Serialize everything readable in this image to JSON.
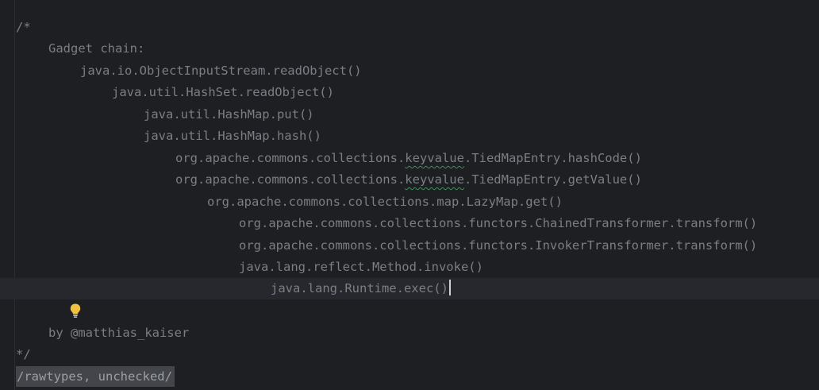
{
  "comment": {
    "open": "/*",
    "header": "Gadget chain:",
    "chain": [
      "java.io.ObjectInputStream.readObject()",
      "java.util.HashSet.readObject()",
      "java.util.HashMap.put()",
      "java.util.HashMap.hash()",
      {
        "before": "org.apache.commons.collections.",
        "flagged": "keyvalue",
        "after": ".TiedMapEntry.hashCode()"
      },
      {
        "before": "org.apache.commons.collections.",
        "flagged": "keyvalue",
        "after": ".TiedMapEntry.getValue()"
      },
      "org.apache.commons.collections.map.LazyMap.get()",
      "org.apache.commons.collections.functors.ChainedTransformer.transform()",
      "org.apache.commons.collections.functors.InvokerTransformer.transform()",
      "java.lang.reflect.Method.invoke()",
      "java.lang.Runtime.exec()"
    ],
    "author": "by @matthias_kaiser",
    "close": "*/"
  },
  "suppress_warnings": "/rawtypes, unchecked/",
  "intention_icon": "lightbulb-icon",
  "colors": {
    "background": "#1e1f22",
    "current_line": "#26282e",
    "comment_text": "#7a7e85",
    "typo_squiggle": "#3f8f5a",
    "bulb": "#f0c040"
  }
}
